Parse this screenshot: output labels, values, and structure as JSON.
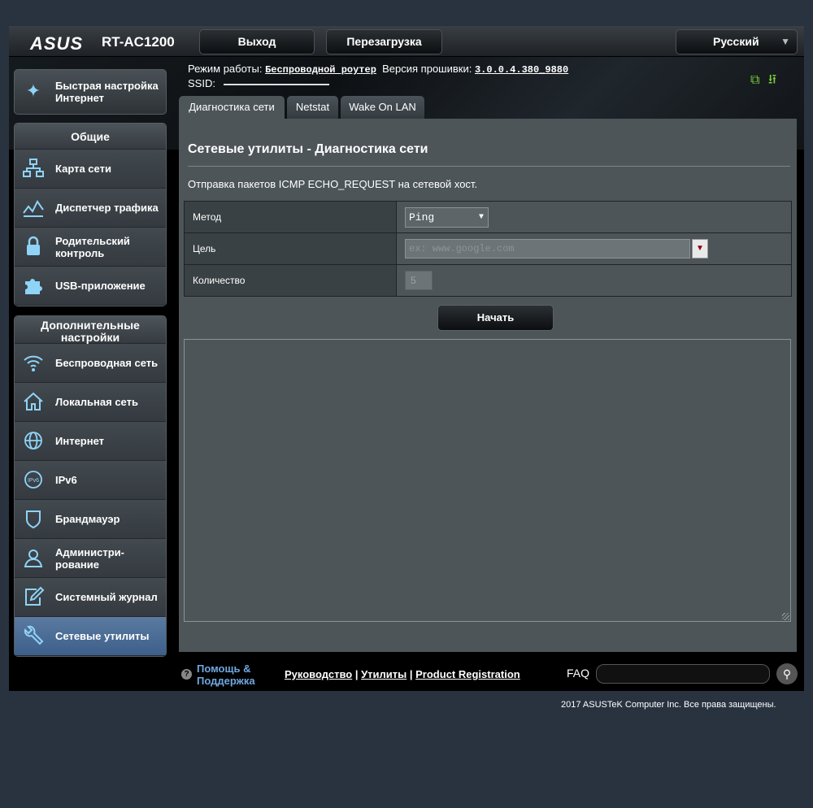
{
  "header": {
    "logo": "ASUS",
    "model": "RT-AC1200",
    "logout_label": "Выход",
    "reboot_label": "Перезагрузка",
    "language": "Русский"
  },
  "info": {
    "mode_label": "Режим работы:",
    "mode_value": "Беспроводной роутер",
    "firmware_label": "Версия прошивки:",
    "firmware_value": "3.0.0.4.380_9880",
    "ssid_label": "SSID:"
  },
  "sidebar": {
    "qis_label": "Быстрая настройка Интернет",
    "general_title": "Общие",
    "general_items": [
      {
        "label": "Карта сети",
        "icon": "network-map-icon"
      },
      {
        "label": "Диспетчер трафика",
        "icon": "traffic-manager-icon"
      },
      {
        "label": "Родительский контроль",
        "icon": "lock-icon"
      },
      {
        "label": "USB-приложение",
        "icon": "puzzle-icon"
      }
    ],
    "advanced_title": "Дополнительные настройки",
    "advanced_items": [
      {
        "label": "Беспроводная сеть",
        "icon": "wifi-icon"
      },
      {
        "label": "Локальная сеть",
        "icon": "home-icon"
      },
      {
        "label": "Интернет",
        "icon": "globe-icon"
      },
      {
        "label": "IPv6",
        "icon": "ipv6-icon"
      },
      {
        "label": "Брандмауэр",
        "icon": "shield-icon"
      },
      {
        "label": "Администри-рование",
        "icon": "admin-user-icon"
      },
      {
        "label": "Системный журнал",
        "icon": "log-edit-icon"
      },
      {
        "label": "Сетевые утилиты",
        "icon": "tools-icon"
      }
    ]
  },
  "tabs": [
    {
      "label": "Диагностика сети",
      "active": true
    },
    {
      "label": "Netstat",
      "active": false
    },
    {
      "label": "Wake On LAN",
      "active": false
    }
  ],
  "main": {
    "title": "Сетевые утилиты - Диагностика сети",
    "description": "Отправка пакетов ICMP ECHO_REQUEST на сетевой хост.",
    "method_label": "Метод",
    "method_value": "Ping",
    "target_label": "Цель",
    "target_placeholder": "ex: www.google.com",
    "count_label": "Количество",
    "count_placeholder": "5",
    "start_label": "Начать",
    "output": ""
  },
  "footer": {
    "help_label": "Помощь & Поддержка",
    "manual_link": "Руководство",
    "utilities_link": "Утилиты",
    "registration_link": "Product Registration",
    "faq_label": "FAQ",
    "copyright": "2017 ASUSTeK Computer Inc. Все права защищены."
  },
  "colors": {
    "page_bg": "#293340",
    "panel_bg": "#4d5559",
    "accent_link": "#6fa8e0",
    "status_green": "#7ccf3a",
    "icon_blue": "#8fd3f7"
  }
}
